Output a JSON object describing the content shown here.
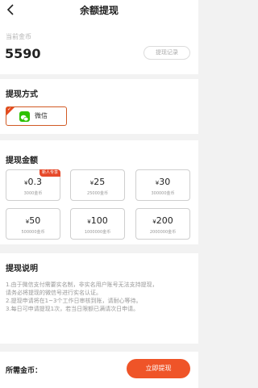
{
  "header": {
    "title": "余额提现",
    "back_icon": "chevron-left-icon"
  },
  "balance": {
    "label": "当前金币",
    "value": "5590",
    "record_button": "提现记录"
  },
  "method": {
    "title": "提现方式",
    "selected": "微信",
    "icon": "wechat-icon",
    "accent": "#e74a1e"
  },
  "amount": {
    "title": "提现金额",
    "currency": "¥",
    "options": [
      {
        "value": "0.3",
        "coins": "3000金币",
        "badge": "新人专享"
      },
      {
        "value": "25",
        "coins": "25000金币"
      },
      {
        "value": "30",
        "coins": "300000金币"
      },
      {
        "value": "50",
        "coins": "500000金币"
      },
      {
        "value": "100",
        "coins": "1000000金币"
      },
      {
        "value": "200",
        "coins": "2000000金币"
      }
    ]
  },
  "notes": {
    "title": "提现说明",
    "lines": [
      "1.由于微信支付需要实名制，非实名用户账号无法支持提现，",
      "请务必将提现的微信号进行实名认证。",
      "2.提现申请将在1~3个工作日审核到账，请耐心等待。",
      "3.每日可申请提现1次，若当日限额已满请次日申请。"
    ]
  },
  "bottom": {
    "label": "所需金币：",
    "submit": "立即提现",
    "submit_color": "#ef5428"
  }
}
